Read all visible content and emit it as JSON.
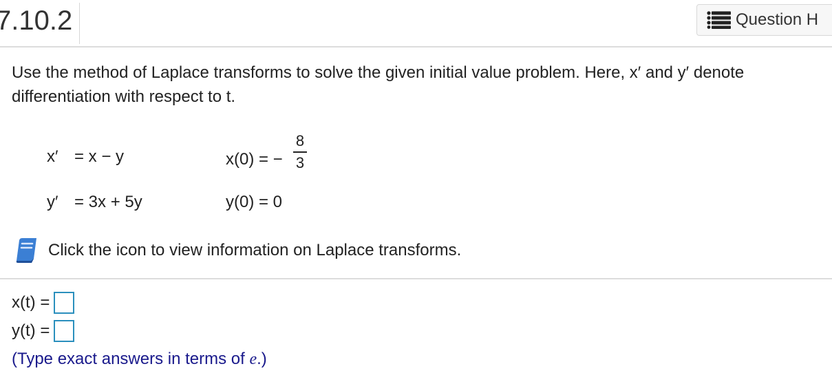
{
  "header": {
    "question_number": "7.10.2",
    "question_button_label": "Question H",
    "question_button_icon": "list-icon"
  },
  "prompt": "Use the method of Laplace transforms to solve the given initial value problem. Here, x′ and y′ denote differentiation with respect to t.",
  "system": {
    "eq1_lhs": "x′",
    "eq1_rhs": "=  x − y",
    "eq2_lhs": "y′",
    "eq2_rhs": "=  3x + 5y",
    "ic1_lhs": "x(0) =  −",
    "ic1_num": "8",
    "ic1_den": "3",
    "ic2": "y(0) = 0"
  },
  "info": {
    "icon": "book-icon",
    "text": "Click the icon to view information on Laplace transforms."
  },
  "answers": {
    "x_label": "x(t) =",
    "y_label": "y(t) =",
    "x_value": "",
    "y_value": ""
  },
  "hint": {
    "prefix": "(Type exact answers in terms of ",
    "var": "e",
    "suffix": ".)"
  },
  "colors": {
    "answer_box_border": "#2a8fbd",
    "hint_text": "#1a1a8c",
    "book_icon": "#3b7fd4"
  }
}
